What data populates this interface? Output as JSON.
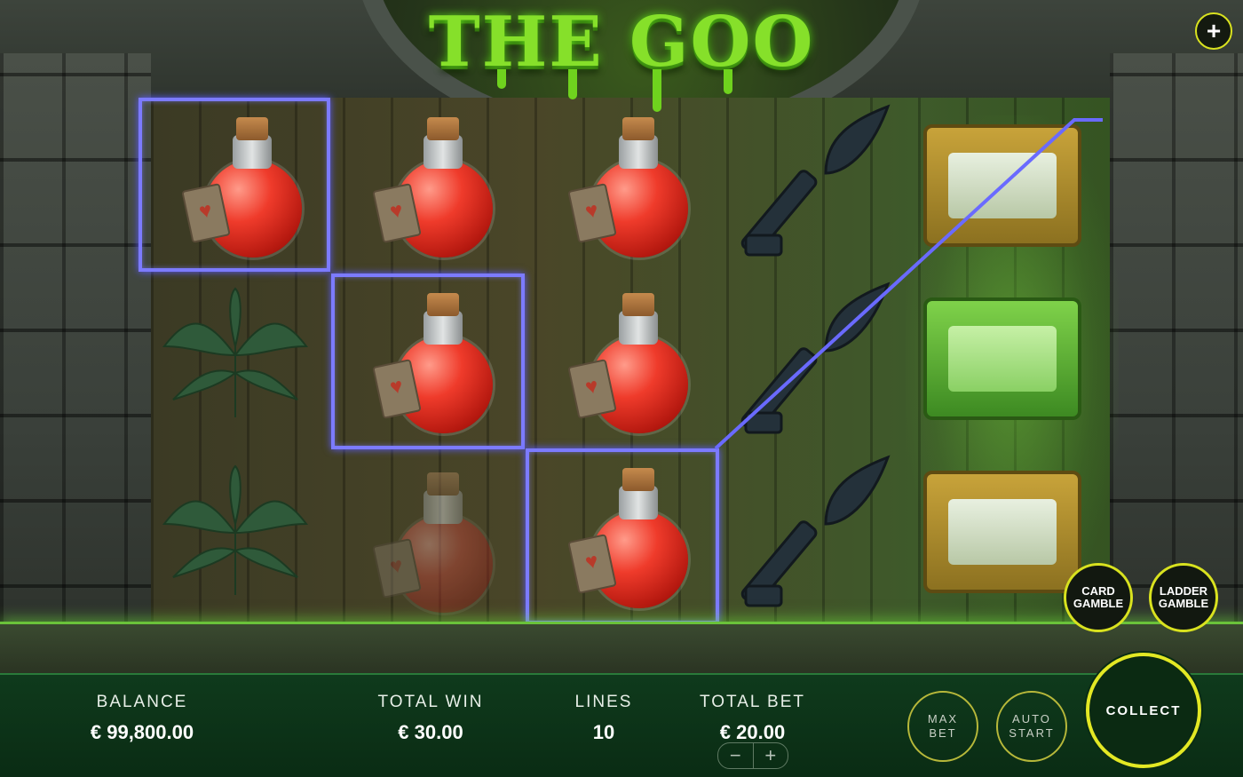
{
  "game": {
    "title": "THE GOO",
    "menu_icon": "plus-icon"
  },
  "reels": {
    "symbols": [
      [
        "potion",
        "leaf",
        "leaf"
      ],
      [
        "potion",
        "potion",
        "potion-dim"
      ],
      [
        "potion",
        "potion",
        "potion"
      ],
      [
        "key",
        "key",
        "key"
      ],
      [
        "chest",
        "chest-green",
        "chest"
      ]
    ],
    "winline_color": "#7c7bff"
  },
  "gamble": {
    "card_label_1": "CARD",
    "card_label_2": "GAMBLE",
    "ladder_label_1": "LADDER",
    "ladder_label_2": "GAMBLE"
  },
  "status_bar": {
    "balance_label": "BALANCE",
    "balance_value": "€ 99,800.00",
    "total_win_label": "TOTAL WIN",
    "total_win_value": "€ 30.00",
    "lines_label": "LINES",
    "lines_value": "10",
    "total_bet_label": "TOTAL BET",
    "total_bet_value": "€ 20.00"
  },
  "controls": {
    "max_bet_1": "MAX",
    "max_bet_2": "BET",
    "auto_start_1": "AUTO",
    "auto_start_2": "START",
    "collect": "COLLECT",
    "decrease": "−",
    "increase": "+"
  },
  "colors": {
    "accent": "#d9e21f",
    "bar_bg": "#0a2c14",
    "title_green": "#86e02a"
  }
}
